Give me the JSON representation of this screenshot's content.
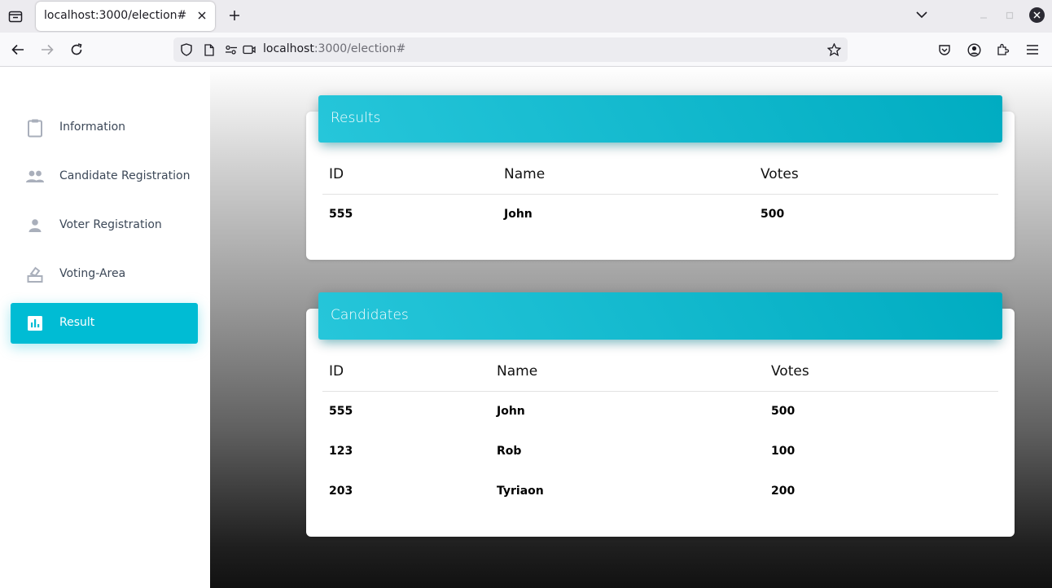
{
  "browser": {
    "tab_title": "localhost:3000/election#",
    "url_host": "localhost",
    "url_path": ":3000/election#"
  },
  "sidebar": {
    "items": [
      {
        "label": "Information",
        "icon": "clipboard-icon",
        "active": false
      },
      {
        "label": "Candidate Registration",
        "icon": "people-icon",
        "active": false
      },
      {
        "label": "Voter Registration",
        "icon": "person-icon",
        "active": false
      },
      {
        "label": "Voting-Area",
        "icon": "ballot-box-icon",
        "active": false
      },
      {
        "label": "Result",
        "icon": "bar-chart-icon",
        "active": true
      }
    ]
  },
  "results_card": {
    "title": "Results",
    "columns": [
      "ID",
      "Name",
      "Votes"
    ],
    "rows": [
      [
        "555",
        "John",
        "500"
      ]
    ]
  },
  "candidates_card": {
    "title": "Candidates",
    "columns": [
      "ID",
      "Name",
      "Votes"
    ],
    "rows": [
      [
        "555",
        "John",
        "500"
      ],
      [
        "123",
        "Rob",
        "100"
      ],
      [
        "203",
        "Tyriaon",
        "200"
      ]
    ]
  },
  "colors": {
    "accent": "#00bcd4",
    "header_gradient_start": "#26c6da",
    "header_gradient_end": "#00acc1"
  }
}
